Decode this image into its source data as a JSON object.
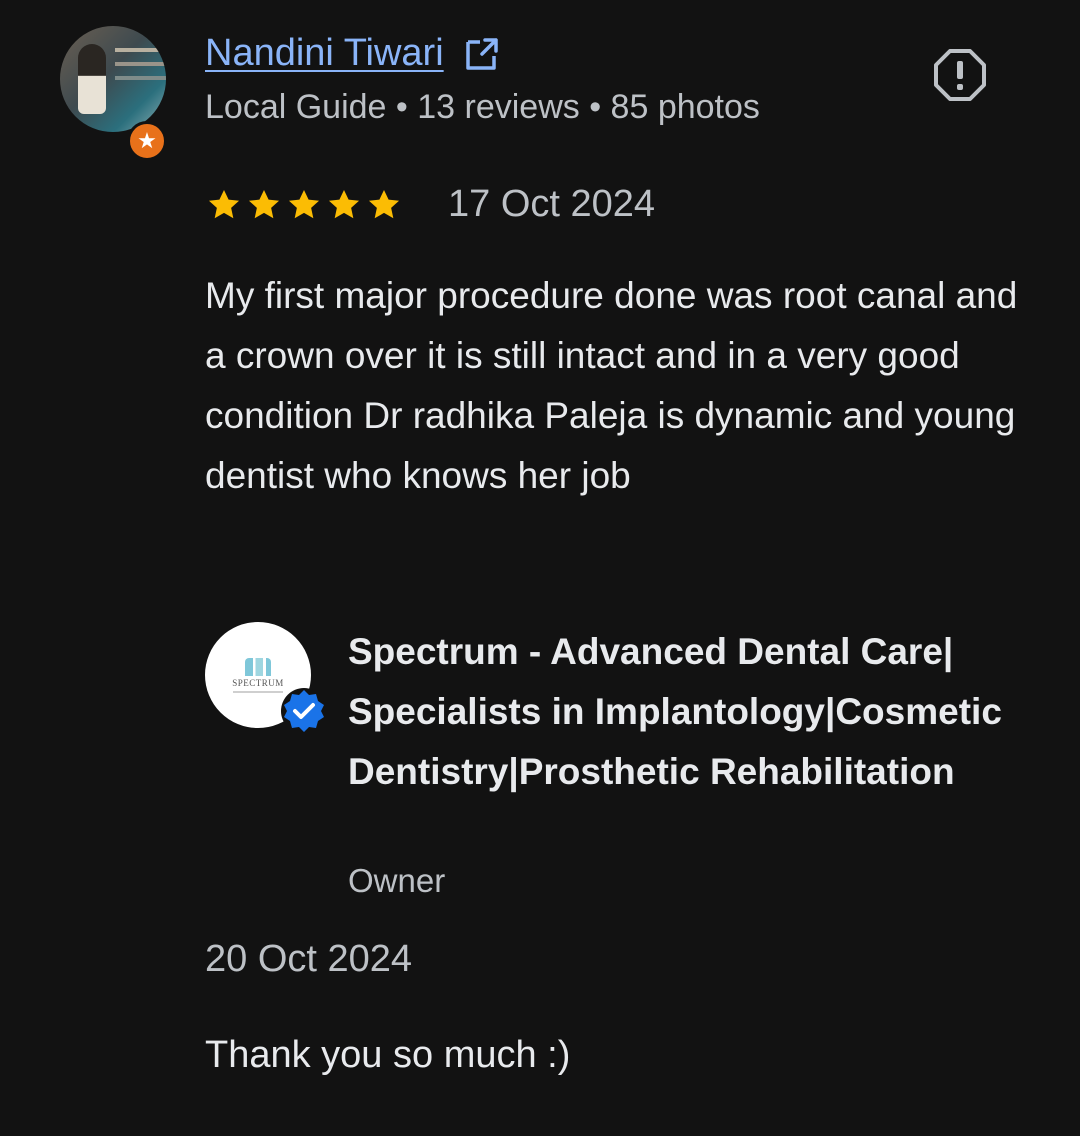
{
  "review": {
    "reviewer": {
      "name": "Nandini Tiwari",
      "meta": "Local Guide • 13 reviews • 85 photos"
    },
    "rating": 5,
    "date": "17 Oct 2024",
    "text": "My first major procedure done was root canal and a crown over it is still intact and in a very good condition Dr radhika Paleja is dynamic and young dentist who knows her job"
  },
  "owner_response": {
    "business_name": "Spectrum - Advanced Dental Care| Specialists in Implantology|Cosmetic Dentistry|Prosthetic Rehabilitation",
    "logo_text": "SPECTRUM",
    "role": "Owner",
    "date": "20 Oct 2024",
    "text": "Thank you so much :)"
  },
  "icons": {
    "external": "open-in-new-icon",
    "report": "report-flag-icon",
    "local_guide": "local-guide-star-badge",
    "verified": "verified-check-badge"
  },
  "colors": {
    "background": "#121212",
    "link": "#8ab4f8",
    "star": "#fbbc04",
    "guide_badge": "#e8711a",
    "verified": "#1a73e8"
  }
}
